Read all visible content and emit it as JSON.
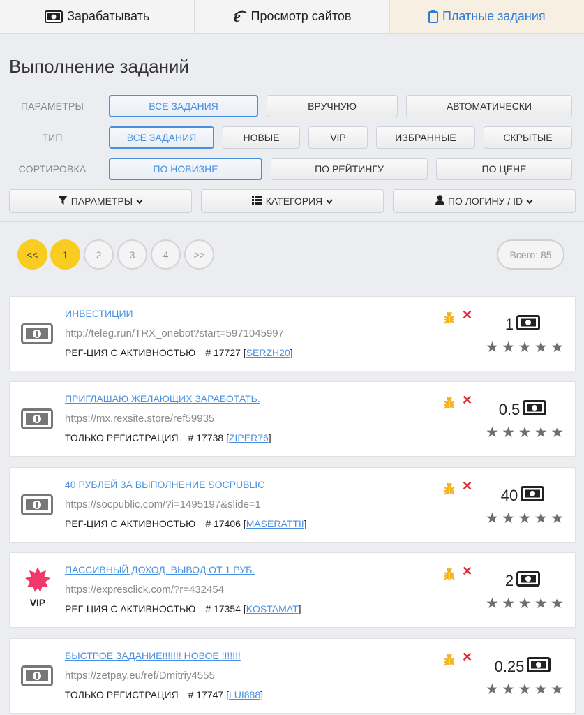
{
  "tabs": [
    {
      "label": "Зарабатывать",
      "icon": "money-icon",
      "active": false
    },
    {
      "label": "Просмотр сайтов",
      "icon": "ie-browser-icon",
      "active": false
    },
    {
      "label": "Платные задания",
      "icon": "clipboard-icon",
      "active": true
    }
  ],
  "page_title": "Выполнение заданий",
  "filters": {
    "params": {
      "label": "ПАРАМЕТРЫ",
      "options": [
        "ВСЕ ЗАДАНИЯ",
        "ВРУЧНУЮ",
        "АВТОМАТИЧЕСКИ"
      ],
      "selected": "ВСЕ ЗАДАНИЯ"
    },
    "type": {
      "label": "ТИП",
      "options": [
        "ВСЕ ЗАДАНИЯ",
        "НОВЫЕ",
        "VIP",
        "ИЗБРАННЫЕ",
        "СКРЫТЫЕ"
      ],
      "selected": "ВСЕ ЗАДАНИЯ"
    },
    "sort": {
      "label": "СОРТИРОВКА",
      "options": [
        "ПО НОВИЗНЕ",
        "ПО РЕЙТИНГУ",
        "ПО ЦЕНЕ"
      ],
      "selected": "ПО НОВИЗНЕ"
    }
  },
  "dropdowns": [
    {
      "label": "ПАРАМЕТРЫ",
      "icon": "filter-icon"
    },
    {
      "label": "КАТЕГОРИЯ",
      "icon": "list-icon"
    },
    {
      "label": "ПО ЛОГИНУ / ID",
      "icon": "user-icon"
    }
  ],
  "pagination": {
    "first": "<<",
    "pages": [
      "1",
      "2",
      "3",
      "4"
    ],
    "current": "1",
    "next": ">>",
    "total_label": "Всего: 85"
  },
  "tasks": [
    {
      "title": "ИНВЕСТИЦИИ",
      "url": "http://teleg.run/TRX_onebot?start=5971045997",
      "type": "РЕГ-ЦИЯ С АКТИВНОСТЬЮ",
      "number": "# 17727",
      "user": "SERZH20",
      "price": "1",
      "vip": false,
      "rating": 0
    },
    {
      "title": "ПРИГЛАШАЮ ЖЕЛАЮЩИХ ЗАРАБОТАТЬ.",
      "url": "https://mx.rexsite.store/ref59935",
      "type": "ТОЛЬКО РЕГИСТРАЦИЯ",
      "number": "# 17738",
      "user": "ZIPER76",
      "price": "0.5",
      "vip": false,
      "rating": 0
    },
    {
      "title": "40 РУБЛЕЙ ЗА ВЫПОЛНЕНИЕ SOCPUBLIC",
      "url": "https://socpublic.com/?i=1495197&slide=1",
      "type": "РЕГ-ЦИЯ С АКТИВНОСТЬЮ",
      "number": "# 17406",
      "user": "MASERATTII",
      "price": "40",
      "vip": false,
      "rating": 0
    },
    {
      "title": "ПАССИВНЫЙ ДОХОД. ВЫВОД ОТ 1 РУБ.",
      "url": "https://expresclick.com/?r=432454",
      "type": "РЕГ-ЦИЯ С АКТИВНОСТЬЮ",
      "number": "# 17354",
      "user": "KOSTAMAT",
      "price": "2",
      "vip": true,
      "vip_label": "VIP",
      "rating": 0
    },
    {
      "title": "БЫСТРОЕ ЗАДАНИЕ!!!!!!! НОВОЕ !!!!!!!",
      "url": "https://zetpay.eu/ref/Dmitriy4555",
      "type": "ТОЛЬКО РЕГИСТРАЦИЯ",
      "number": "# 17747",
      "user": "LUI888",
      "price": "0.25",
      "vip": false,
      "rating": 0
    }
  ],
  "colors": {
    "accent": "#4a90e2",
    "yellow": "#f9cc21",
    "red": "#e02b3c",
    "vip_star": "#f0386b"
  }
}
